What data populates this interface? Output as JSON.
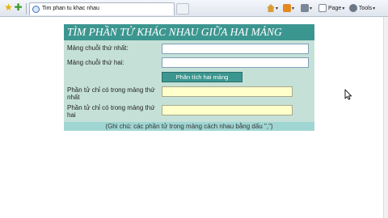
{
  "browser": {
    "tab_title": "Tim phan tu khac nhau",
    "toolbar": {
      "page_label": "Page",
      "tools_label": "Tools"
    },
    "icons": [
      "favorites-star-icon",
      "add-favorite-icon",
      "home-icon",
      "feeds-icon",
      "print-icon",
      "page-icon",
      "tools-icon"
    ]
  },
  "form": {
    "title": "TÌM PHẦN TỬ KHÁC NHAU GIỮA HAI MẢNG",
    "label_array1": "Mảng chuỗi thứ nhất:",
    "label_array2": "Mảng chuỗi thứ hai:",
    "array1_value": "",
    "array2_value": "",
    "button_label": "Phân tích hai mảng",
    "label_only1": "Phần tử chỉ có trong mảng thứ nhất",
    "label_only2": "Phần tử chỉ có trong mảng thứ hai",
    "only1_value": "",
    "only2_value": "",
    "note": "(Ghi chú: các phần tử trong mảng cách nhau bằng dấu \",\")"
  },
  "colors": {
    "header_bg": "#3c9690",
    "form_bg": "#c5e1d7",
    "note_bg": "#9fd6d3",
    "result_bg": "#ffffcc"
  }
}
